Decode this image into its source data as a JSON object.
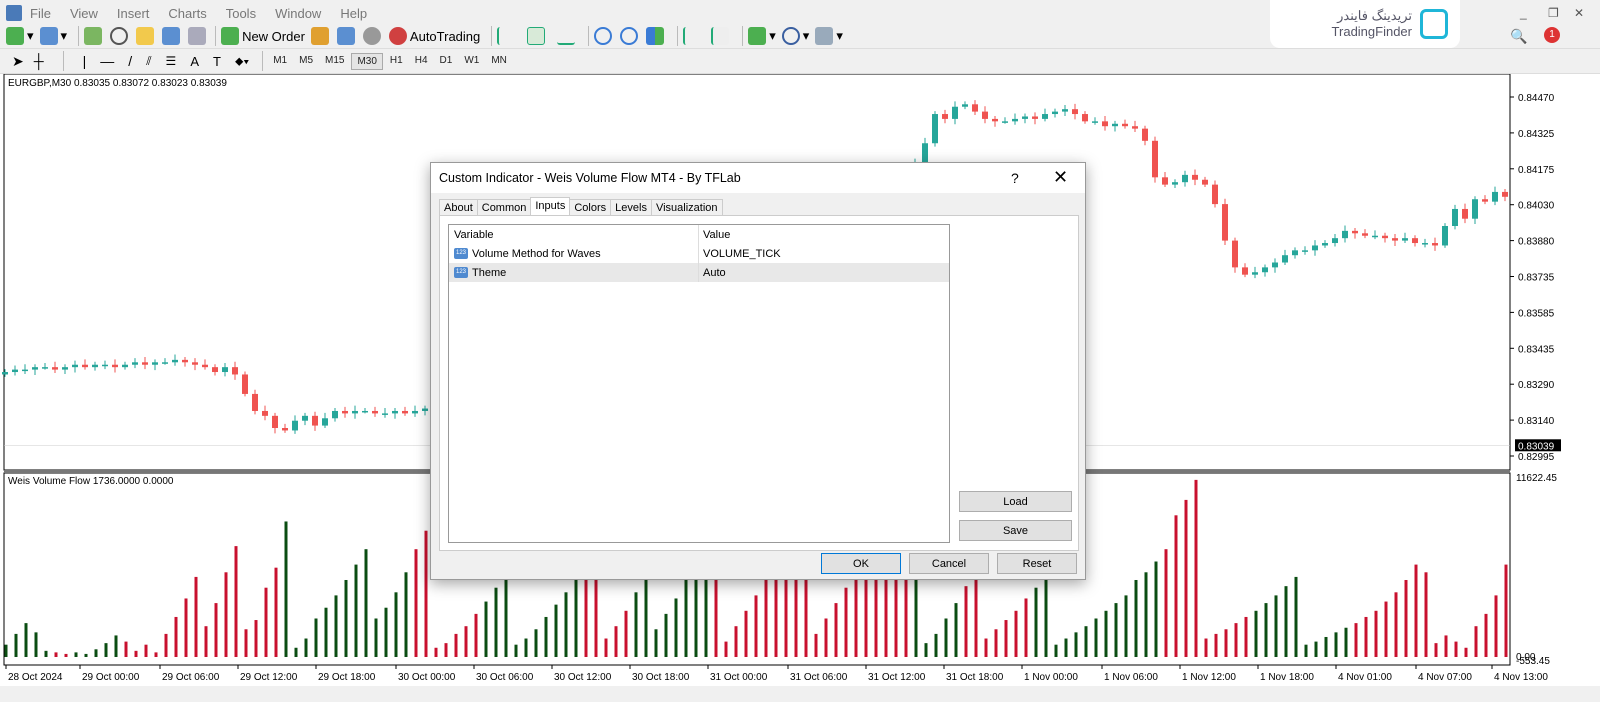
{
  "menu": [
    "File",
    "View",
    "Insert",
    "Charts",
    "Tools",
    "Window",
    "Help"
  ],
  "logo": {
    "text_fa": "تریدینگ فایندر",
    "text": "TradingFinder"
  },
  "notifications": "1",
  "toolbar": {
    "new_order": "New Order",
    "autotrading": "AutoTrading",
    "timeframes": [
      "M1",
      "M5",
      "M15",
      "M30",
      "H1",
      "H4",
      "D1",
      "W1",
      "MN"
    ],
    "active_timeframe": "M30"
  },
  "chart": {
    "header": "EURGBP,M30  0.83035 0.83072 0.83023 0.83039",
    "price_ticks": [
      "0.84470",
      "0.84325",
      "0.84175",
      "0.84030",
      "0.83880",
      "0.83735",
      "0.83585",
      "0.83435",
      "0.83290",
      "0.83140",
      "0.82995"
    ],
    "current_price": "0.83039",
    "colors": {
      "up": "#26a69a",
      "down": "#ef5350",
      "vol_up": "#0b4d12",
      "vol_down": "#c8102e"
    },
    "closes": [
      0.8334,
      0.8335,
      0.8335,
      0.8336,
      0.8336,
      0.8335,
      0.8336,
      0.8337,
      0.8336,
      0.8337,
      0.8337,
      0.8336,
      0.8337,
      0.8338,
      0.8337,
      0.8338,
      0.8338,
      0.8339,
      0.8338,
      0.8337,
      0.8336,
      0.8334,
      0.8336,
      0.8333,
      0.8325,
      0.8318,
      0.8316,
      0.8311,
      0.831,
      0.8314,
      0.8316,
      0.8312,
      0.8315,
      0.8318,
      0.8317,
      0.8318,
      0.8318,
      0.8317,
      0.8317,
      0.8318,
      0.8317,
      0.8318,
      0.8319,
      0.8321,
      0.8323,
      0.8325,
      0.8327,
      0.8329,
      0.8331,
      0.8333,
      0.8335,
      0.8337,
      0.8339,
      0.8341,
      0.8343,
      0.8345,
      0.8347,
      0.8349,
      0.8351,
      0.8353,
      0.8355,
      0.8357,
      0.8359,
      0.8361,
      0.8363,
      0.8365,
      0.8367,
      0.8369,
      0.8371,
      0.8373,
      0.8375,
      0.8377,
      0.8379,
      0.8381,
      0.8383,
      0.8385,
      0.8387,
      0.8389,
      0.8391,
      0.8393,
      0.8395,
      0.8397,
      0.8399,
      0.8401,
      0.8403,
      0.8405,
      0.8407,
      0.8409,
      0.8411,
      0.8414,
      0.8417,
      0.842,
      0.8428,
      0.844,
      0.8438,
      0.8443,
      0.8444,
      0.8441,
      0.8438,
      0.8437,
      0.8437,
      0.8438,
      0.8439,
      0.8438,
      0.844,
      0.8441,
      0.8442,
      0.844,
      0.8437,
      0.8437,
      0.8435,
      0.8436,
      0.8435,
      0.8434,
      0.8429,
      0.8414,
      0.8411,
      0.8412,
      0.8415,
      0.8413,
      0.8411,
      0.8403,
      0.8388,
      0.8377,
      0.8374,
      0.8375,
      0.8377,
      0.8379,
      0.8382,
      0.8384,
      0.8384,
      0.8386,
      0.8387,
      0.8389,
      0.8392,
      0.8391,
      0.839,
      0.839,
      0.8389,
      0.8388,
      0.8389,
      0.8387,
      0.8387,
      0.8386,
      0.8394,
      0.8401,
      0.8397,
      0.8405,
      0.8404,
      0.8408,
      0.8406
    ],
    "price_range": [
      0.82995,
      0.8447
    ],
    "indicator_header": "Weis Volume Flow 1736.0000 0.0000",
    "indicator_ticks": [
      "11622.45",
      "0.00",
      "-553.45"
    ],
    "indicator_range": [
      0,
      11622.45
    ],
    "volumes": [
      800,
      1500,
      2200,
      1600,
      400,
      300,
      200,
      300,
      200,
      500,
      900,
      1400,
      1000,
      400,
      800,
      300,
      1500,
      2600,
      3800,
      5200,
      2000,
      3500,
      5500,
      7200,
      1800,
      2400,
      4500,
      5800,
      8800,
      600,
      1200,
      2500,
      3200,
      4000,
      5000,
      6000,
      7000,
      2500,
      3200,
      4200,
      5500,
      7000,
      8200,
      600,
      900,
      1500,
      2000,
      2800,
      3600,
      4500,
      5500,
      800,
      1200,
      1800,
      2600,
      3400,
      4200,
      5500,
      7000,
      8500,
      1200,
      2000,
      3000,
      4200,
      5500,
      1800,
      2800,
      3800,
      5000,
      6800,
      8000,
      9000,
      1000,
      2000,
      3000,
      4000,
      5500,
      7000,
      8500,
      9500,
      10500,
      1500,
      2500,
      3500,
      4500,
      6000,
      7500,
      8500,
      9200,
      10000,
      10500,
      11000,
      900,
      1500,
      2500,
      3500,
      4600,
      5200,
      1200,
      1800,
      2400,
      3000,
      3800,
      4500,
      5500,
      800,
      1200,
      1600,
      2000,
      2500,
      3000,
      3500,
      4000,
      5000,
      5500,
      6200,
      7000,
      9200,
      10200,
      11500,
      1200,
      1500,
      1800,
      2200,
      2600,
      3000,
      3500,
      4000,
      4600,
      5200,
      800,
      1000,
      1300,
      1600,
      1900,
      2200,
      2600,
      3000,
      3600,
      4200,
      5000,
      6000,
      5500,
      900,
      1400,
      1000,
      600,
      2000,
      2800,
      4000,
      6000
    ],
    "vol_dirs": "gggggrrgggggrrrrrrrrrrrrrrrrgggggggggggggrrrrrrrggggggggggrrrrrggggggggrrrrrrrrrrrrrrrrrrrrgggggrrrrrrrgggggggggggggrrrrrrrrrggggggggggrrrrrrrrrrrrrrrrgrrrgggg",
    "time_labels": [
      "28 Oct 2024",
      "29 Oct 00:00",
      "29 Oct 06:00",
      "29 Oct 12:00",
      "29 Oct 18:00",
      "30 Oct 00:00",
      "30 Oct 06:00",
      "30 Oct 12:00",
      "30 Oct 18:00",
      "31 Oct 00:00",
      "31 Oct 06:00",
      "31 Oct 12:00",
      "31 Oct 18:00",
      "1 Nov 00:00",
      "1 Nov 06:00",
      "1 Nov 12:00",
      "1 Nov 18:00",
      "4 Nov 01:00",
      "4 Nov 07:00",
      "4 Nov 13:00"
    ]
  },
  "dialog": {
    "title": "Custom Indicator - Weis Volume Flow MT4 - By TFLab",
    "help": "?",
    "close": "✕",
    "tabs": [
      "About",
      "Common",
      "Inputs",
      "Colors",
      "Levels",
      "Visualization"
    ],
    "active_tab": "Inputs",
    "columns": [
      "Variable",
      "Value"
    ],
    "rows": [
      {
        "variable": "Volume Method for Waves",
        "value": "VOLUME_TICK"
      },
      {
        "variable": "Theme",
        "value": "Auto"
      }
    ],
    "load": "Load",
    "save": "Save",
    "ok": "OK",
    "cancel": "Cancel",
    "reset": "Reset"
  }
}
